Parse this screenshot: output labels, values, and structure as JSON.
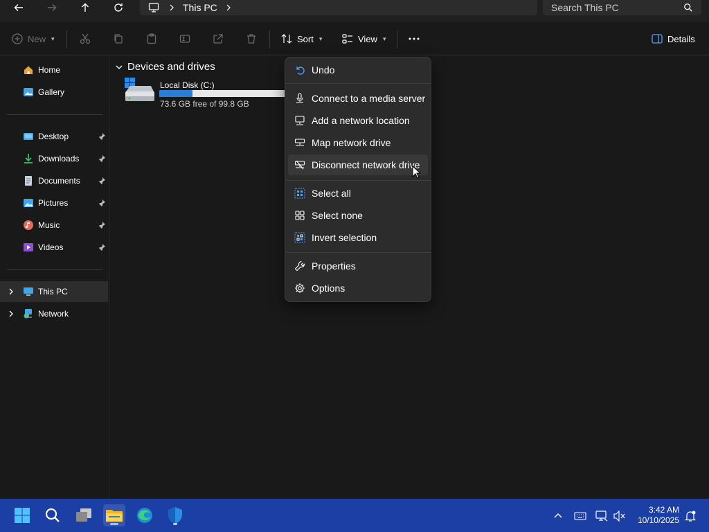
{
  "address": {
    "crumb": "This PC",
    "search_placeholder": "Search This PC"
  },
  "toolbar": {
    "new_label": "New",
    "sort_label": "Sort",
    "view_label": "View",
    "details_label": "Details"
  },
  "sidebar": {
    "quick": [
      {
        "label": "Home",
        "icon": "home-icon"
      },
      {
        "label": "Gallery",
        "icon": "gallery-icon"
      }
    ],
    "pinned": [
      {
        "label": "Desktop",
        "icon": "desktop-folder-icon"
      },
      {
        "label": "Downloads",
        "icon": "downloads-icon"
      },
      {
        "label": "Documents",
        "icon": "documents-icon"
      },
      {
        "label": "Pictures",
        "icon": "pictures-icon"
      },
      {
        "label": "Music",
        "icon": "music-icon"
      },
      {
        "label": "Videos",
        "icon": "videos-icon"
      }
    ],
    "locations": [
      {
        "label": "This PC",
        "icon": "this-pc-icon"
      },
      {
        "label": "Network",
        "icon": "network-icon"
      }
    ]
  },
  "content": {
    "section_title": "Devices and drives",
    "drive": {
      "name": "Local Disk (C:)",
      "free_text": "73.6 GB free of 99.8 GB",
      "used_fraction": 0.26
    }
  },
  "menu": {
    "items": [
      {
        "label": "Undo",
        "icon": "undo-icon"
      },
      {
        "label": "Connect to a media server",
        "icon": "media-server-icon"
      },
      {
        "label": "Add a network location",
        "icon": "network-location-icon"
      },
      {
        "label": "Map network drive",
        "icon": "map-drive-icon"
      },
      {
        "label": "Disconnect network drive",
        "icon": "disconnect-drive-icon"
      },
      {
        "label": "Select all",
        "icon": "select-all-icon"
      },
      {
        "label": "Select none",
        "icon": "select-none-icon"
      },
      {
        "label": "Invert selection",
        "icon": "invert-selection-icon"
      },
      {
        "label": "Properties",
        "icon": "wrench-icon"
      },
      {
        "label": "Options",
        "icon": "gear-icon"
      }
    ]
  },
  "taskbar": {
    "time": "3:42 AM",
    "date": "10/10/2025"
  },
  "colors": {
    "accent": "#2a7fd4",
    "taskbar": "#1c3fa6",
    "menu_bg": "#2c2c2c"
  }
}
